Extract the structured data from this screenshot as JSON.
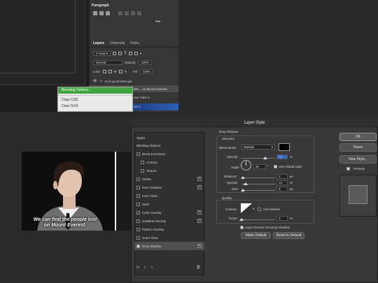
{
  "paragraph_panel": {
    "title": "Paragraph",
    "more": "•••"
  },
  "layers_panel": {
    "tabs": [
      "Layers",
      "Channels",
      "Paths"
    ],
    "filter_label": "Kind",
    "blend_mode": "Normal",
    "opacity_label": "Opacity:",
    "opacity_value": "100%",
    "lock_label": "Lock:",
    "fill_label": "Fill:",
    "fill_value": "100%",
    "layers": [
      {
        "name": "As if you'd even go!",
        "type": "T"
      },
      {
        "name": "des... on Mount Everest.",
        "type": ""
      },
      {
        "name": "ove Color 1",
        "type": ""
      },
      {
        "name": "ion 1",
        "type": ""
      }
    ]
  },
  "context_menu": {
    "items": [
      "Blending Options...",
      "Copy CSS",
      "Copy SVG"
    ]
  },
  "photo_caption": {
    "line1": "We can find the people lost",
    "line2": "on Mount Everest."
  },
  "dialog": {
    "title": "Layer Style",
    "styles_header": "Styles",
    "style_items": [
      {
        "label": "Blending Options",
        "cb": false,
        "hascb": false,
        "plus": false,
        "indent": false
      },
      {
        "label": "Bevel & Emboss",
        "cb": false,
        "hascb": true,
        "plus": false,
        "indent": false
      },
      {
        "label": "Contour",
        "cb": false,
        "hascb": true,
        "plus": false,
        "indent": true
      },
      {
        "label": "Texture",
        "cb": false,
        "hascb": true,
        "plus": false,
        "indent": true
      },
      {
        "label": "Stroke",
        "cb": false,
        "hascb": true,
        "plus": true,
        "indent": false
      },
      {
        "label": "Inner Shadow",
        "cb": false,
        "hascb": true,
        "plus": true,
        "indent": false
      },
      {
        "label": "Inner Glow",
        "cb": false,
        "hascb": true,
        "plus": false,
        "indent": false
      },
      {
        "label": "Satin",
        "cb": false,
        "hascb": true,
        "plus": false,
        "indent": false
      },
      {
        "label": "Color Overlay",
        "cb": false,
        "hascb": true,
        "plus": true,
        "indent": false
      },
      {
        "label": "Gradient Overlay",
        "cb": false,
        "hascb": true,
        "plus": true,
        "indent": false
      },
      {
        "label": "Pattern Overlay",
        "cb": false,
        "hascb": true,
        "plus": false,
        "indent": false
      },
      {
        "label": "Outer Glow",
        "cb": false,
        "hascb": true,
        "plus": false,
        "indent": false
      },
      {
        "label": "Drop Shadow",
        "cb": true,
        "hascb": true,
        "plus": true,
        "indent": false
      }
    ],
    "fx_label": "fx",
    "drop_shadow": {
      "section_title": "Drop Shadow",
      "structure_title": "Structure",
      "blend_mode_label": "Blend Mode:",
      "blend_mode_value": "Multiply",
      "opacity_label": "Opacity:",
      "opacity_value": "71",
      "opacity_fraction": 0.71,
      "angle_label": "Angle:",
      "angle_value": "90",
      "use_global_light": "Use Global Light",
      "distance_label": "Distance:",
      "distance_value": "2",
      "distance_fraction": 0.05,
      "spread_label": "Spread:",
      "spread_value": "13",
      "spread_fraction": 0.13,
      "size_label": "Size:",
      "size_value": "9",
      "size_fraction": 0.04,
      "unit_percent": "%",
      "unit_px": "px",
      "unit_deg": "°",
      "quality_title": "Quality",
      "contour_label": "Contour:",
      "anti_aliased": "Anti-aliased",
      "noise_label": "Noise:",
      "noise_value": "0",
      "noise_fraction": 0,
      "knockout": "Layer Knocks Out Drop Shadow",
      "make_default": "Make Default",
      "reset_default": "Reset to Default"
    },
    "buttons": {
      "ok": "OK",
      "reset": "Reset",
      "new_style": "New Style...",
      "preview": "Preview"
    }
  },
  "colors": {
    "highlight_green": "#3fa43f",
    "shadow_color": "#000000"
  }
}
